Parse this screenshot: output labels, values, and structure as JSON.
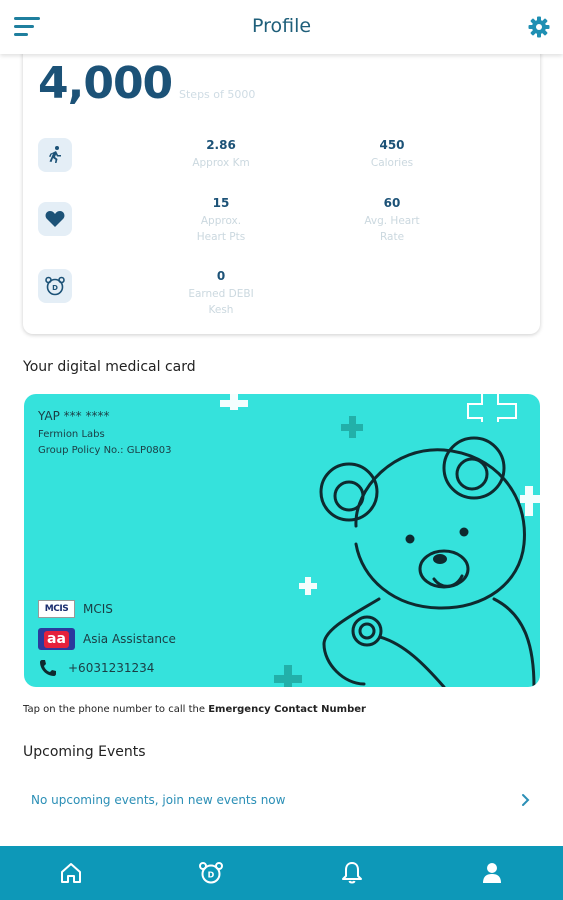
{
  "header": {
    "title": "Profile",
    "menu_icon": "hamburger-menu-icon",
    "settings_icon": "gear-icon"
  },
  "steps": {
    "count": "4,000",
    "goal_text": "Steps of 5000",
    "metrics": [
      {
        "icon": "running-person-icon",
        "value_a": "2.86",
        "label_a": "Approx Km",
        "value_b": "450",
        "label_b": "Calories"
      },
      {
        "icon": "heart-icon",
        "value_a": "15",
        "label_a": "Approx. Heart Pts",
        "value_b": "60",
        "label_b": "Avg. Heart Rate"
      },
      {
        "icon": "bear-coin-icon",
        "value_a": "0",
        "label_a": "Earned DEBI Kesh"
      }
    ]
  },
  "medical_card": {
    "section_title": "Your digital medical card",
    "holder_name": "YAP *** ****",
    "company": "Fermion Labs",
    "policy": "Group Policy No.: GLP0803",
    "insurer_logo_text": "MCIS",
    "insurer": "MCIS",
    "assistance_logo_text": "aa",
    "assistance": "Asia Assistance",
    "phone": "+6031231234",
    "card_color": "#35e2dc",
    "illustration": "bear-doctor-with-stethoscope"
  },
  "tap_note": {
    "prefix": "Tap on the phone number to call the ",
    "emphasis": "Emergency Contact Number"
  },
  "events": {
    "section_title": "Upcoming Events",
    "empty_text": "No upcoming events, join new events now",
    "chevron_icon": "chevron-right-icon"
  },
  "bottom_nav": {
    "color": "#0d98b8",
    "items": [
      {
        "icon": "home-icon"
      },
      {
        "icon": "bear-coin-icon"
      },
      {
        "icon": "bell-icon"
      },
      {
        "icon": "user-icon",
        "active": true
      }
    ]
  },
  "colors": {
    "accent": "#1f7f9e",
    "title": "#1c5277",
    "link": "#2b8fb6"
  }
}
